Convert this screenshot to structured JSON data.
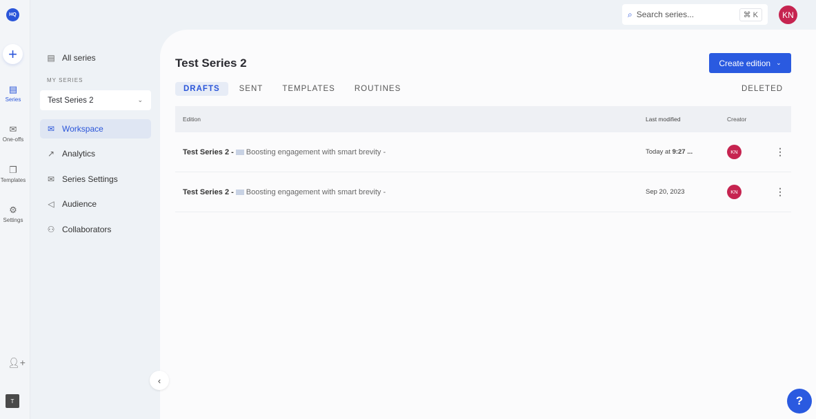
{
  "rail": {
    "logo": "HQ",
    "items": [
      {
        "label": "Series",
        "icon": "series-icon"
      },
      {
        "label": "One-offs",
        "icon": "envelope-icon"
      },
      {
        "label": "Templates",
        "icon": "copy-icon"
      },
      {
        "label": "Settings",
        "icon": "gear-icon"
      }
    ],
    "workspace_initial": "T"
  },
  "sidebar": {
    "all_series": "All series",
    "section": "MY SERIES",
    "selected_series": "Test Series 2",
    "items": [
      {
        "label": "Workspace"
      },
      {
        "label": "Analytics"
      },
      {
        "label": "Series Settings"
      },
      {
        "label": "Audience"
      },
      {
        "label": "Collaborators"
      }
    ]
  },
  "header": {
    "search_placeholder": "Search series...",
    "shortcut": "⌘ K",
    "user_initials": "KN"
  },
  "main": {
    "title": "Test Series 2",
    "create_label": "Create edition",
    "tabs": [
      "DRAFTS",
      "SENT",
      "TEMPLATES",
      "ROUTINES"
    ],
    "deleted": "DELETED",
    "columns": [
      "Edition",
      "Last modified",
      "Creator"
    ],
    "rows": [
      {
        "series": "Test Series 2 -",
        "title": "Boosting engagement with smart brevity -",
        "mod_prefix": "Today at ",
        "mod_bold": "9:27 ...",
        "creator": "KN"
      },
      {
        "series": "Test Series 2 -",
        "title": "Boosting engagement with smart brevity -",
        "mod_prefix": "Sep 20, 2023",
        "mod_bold": "",
        "creator": "KN"
      }
    ]
  }
}
